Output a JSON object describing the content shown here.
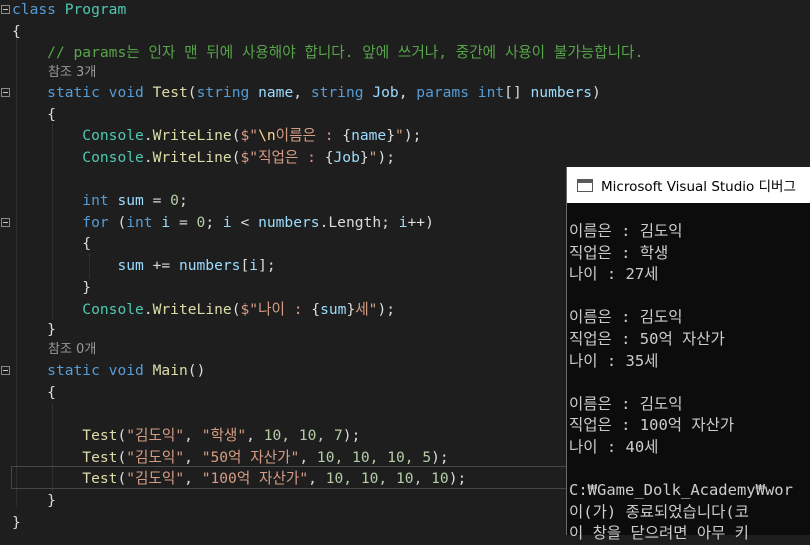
{
  "editor": {
    "l1": {
      "kw": "class",
      "name": "Program"
    },
    "l2": {
      "brace": "{"
    },
    "l3": {
      "comment": "// params는 인자 맨 뒤에 사용해야 합니다. 앞에 쓰거나, 중간에 사용이 불가능합니다."
    },
    "lens1": "참조 3개",
    "l4": {
      "kw1": "static",
      "kw2": "void",
      "fn": "Test",
      "p1": "(",
      "t1": "string",
      "id1": "name",
      "c1": ", ",
      "t2": "string",
      "id2": "Job",
      "c2": ", ",
      "k3": "params",
      "t3": "int",
      "br": "[] ",
      "id3": "numbers",
      "p2": ")"
    },
    "l5": {
      "brace": "{"
    },
    "l6": {
      "ty": "Console",
      "dot": ".",
      "fn": "WriteLine",
      "p1": "(",
      "s1": "$\"",
      "esc": "\\n",
      "s2": "이름은 : ",
      "ob": "{",
      "id": "name",
      "cb": "}",
      "s3": "\"",
      "p2": ");"
    },
    "l7": {
      "ty": "Console",
      "dot": ".",
      "fn": "WriteLine",
      "p1": "(",
      "s1": "$\"",
      "s2": "직업은 : ",
      "ob": "{",
      "id": "Job",
      "cb": "}",
      "s3": "\"",
      "p2": ");"
    },
    "l8": {
      "kw": "int",
      "id": "sum",
      "op": " = ",
      "num": "0",
      "semi": ";"
    },
    "l9": {
      "kw1": "for",
      "p1": " (",
      "kw2": "int",
      "id1": "i",
      "op1": " = ",
      "num": "0",
      "s1": "; ",
      "id2": "i",
      "op2": " < ",
      "id3": "numbers",
      "dot": ".",
      "id4": "Length",
      "s2": "; ",
      "id5": "i",
      "op3": "++",
      "p2": ")"
    },
    "l10": {
      "brace": "{"
    },
    "l11": {
      "id1": "sum",
      "op": " += ",
      "id2": "numbers",
      "b1": "[",
      "id3": "i",
      "b2": "];"
    },
    "l12": {
      "brace": "}"
    },
    "l13": {
      "ty": "Console",
      "dot": ".",
      "fn": "WriteLine",
      "p1": "(",
      "s1": "$\"",
      "s2": "나이 : ",
      "ob": "{",
      "id": "sum",
      "cb": "}",
      "s3": "세\"",
      "p2": ");"
    },
    "l14": {
      "brace": "}"
    },
    "lens2": "참조 0개",
    "l15": {
      "kw1": "static",
      "kw2": "void",
      "fn": "Main",
      "p": "()"
    },
    "l16": {
      "brace": "{"
    },
    "calls": [
      {
        "fn": "Test",
        "p1": "(",
        "s1": "\"김도익\"",
        "c1": ", ",
        "s2": "\"학생\"",
        "c2": ", ",
        "args": "10, 10, 7",
        "p2": ");"
      },
      {
        "fn": "Test",
        "p1": "(",
        "s1": "\"김도익\"",
        "c1": ", ",
        "s2": "\"50억 자산가\"",
        "c2": ", ",
        "args": "10, 10, 10, 5",
        "p2": ");"
      },
      {
        "fn": "Test",
        "p1": "(",
        "s1": "\"김도익\"",
        "c1": ", ",
        "s2": "\"100억 자산가\"",
        "c2": ", ",
        "args": "10, 10, 10, 10",
        "p2": ");"
      }
    ],
    "l20": {
      "brace": "}"
    },
    "l21": {
      "brace": "}"
    }
  },
  "console": {
    "title": "Microsoft Visual Studio 디버그",
    "lines": [
      "이름은 : 김도익",
      "직업은 : 학생",
      "나이 : 27세",
      "",
      "이름은 : 김도익",
      "직업은 : 50억 자산가",
      "나이 : 35세",
      "",
      "이름은 : 김도익",
      "직업은 : 100억 자산가",
      "나이 : 40세",
      "",
      "C:₩Game_Dolk_Academy₩wor",
      "이(가) 종료되었습니다(코",
      "이 창을 닫으려면 아무 키"
    ]
  }
}
